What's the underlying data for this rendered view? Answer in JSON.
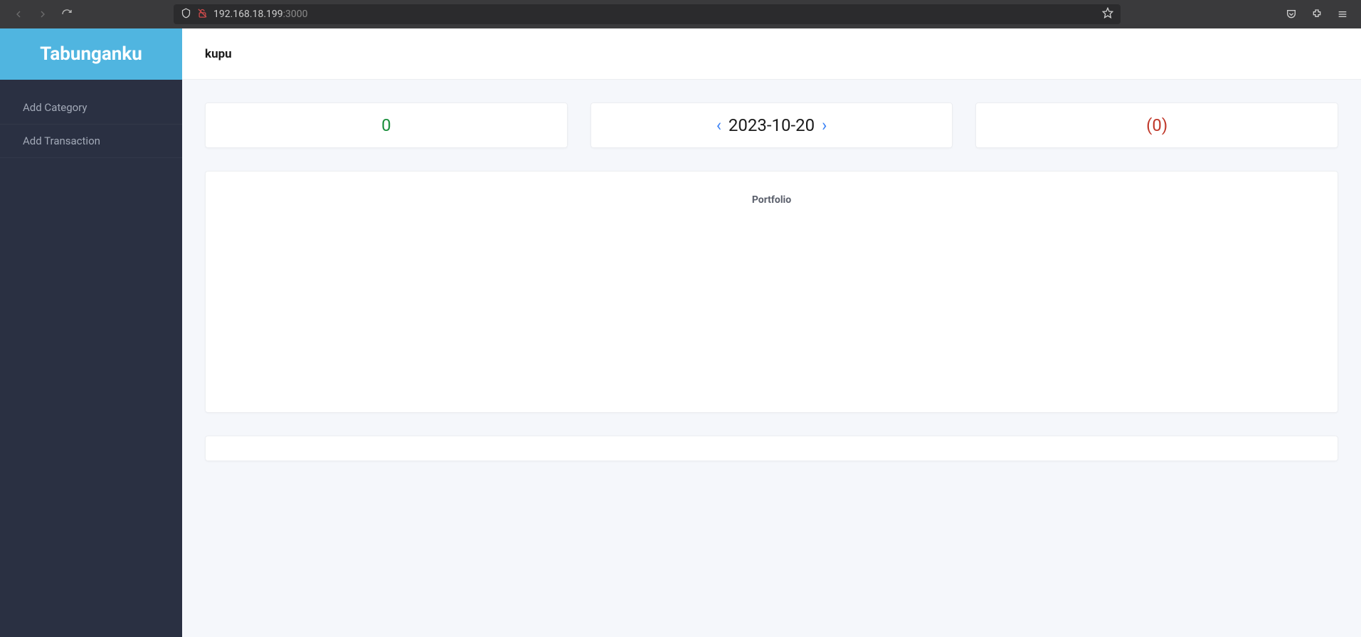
{
  "browser": {
    "url_host": "192.168.18.199",
    "url_port": ":3000"
  },
  "sidebar": {
    "brand": "Tabunganku",
    "items": [
      {
        "label": "Add Category"
      },
      {
        "label": "Add Transaction"
      }
    ]
  },
  "header": {
    "title": "kupu"
  },
  "stats": {
    "left_value": "0",
    "current_date": "2023-10-20",
    "right_value": "(0)"
  },
  "portfolio": {
    "title": "Portfolio"
  }
}
